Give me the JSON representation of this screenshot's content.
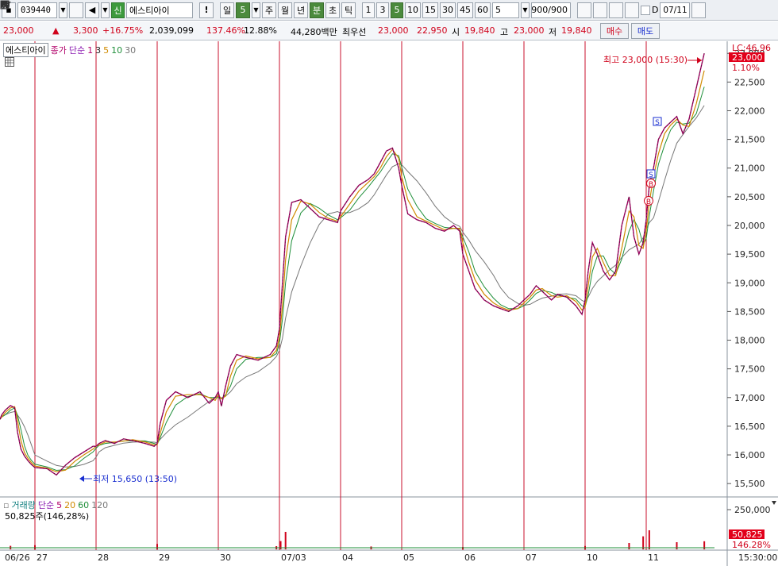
{
  "toolbar": {
    "stock_code": "039440",
    "credit_badge": "신",
    "stock_name": "에스티아이",
    "alert_label": "!",
    "period_value_label": "일",
    "period_value_num": "5",
    "periods": [
      "주",
      "월",
      "년",
      "분",
      "초",
      "틱"
    ],
    "intervals": [
      "1",
      "3",
      "5",
      "10",
      "15",
      "30",
      "45",
      "60"
    ],
    "interval_active": "5",
    "custom_interval": "5",
    "count": "900/900",
    "checkbox_label": "D",
    "date": "07/11"
  },
  "quote": {
    "price": "23,000",
    "change_arrow": "▲",
    "change": "3,300",
    "change_pct": "+16.75%",
    "volume": "2,039,099",
    "volume_ratio": "137.46%",
    "turnover": "12.88%",
    "amount": "44,280백만",
    "priority_label": "최우선",
    "ask": "23,000",
    "bid": "22,950",
    "open_label": "시",
    "open": "19,840",
    "high_label": "고",
    "high": "23,000",
    "low_label": "저",
    "low": "19,840",
    "buy_label": "매수",
    "sell_label": "매도"
  },
  "price_legend": {
    "name": "에스티아이",
    "series_label": "종가",
    "ma_type": "단순",
    "periods": [
      "1",
      "3",
      "5",
      "10",
      "30"
    ]
  },
  "volume_legend": {
    "name": "거래량",
    "ma_type": "단순",
    "periods": [
      "5",
      "20",
      "60",
      "120"
    ],
    "current": "50,825주(146,28%)"
  },
  "annotations": {
    "high": "최고 23,000 (15:30)",
    "low": "최저 15,650 (13:50)",
    "lc_label": "LC:46.96",
    "last_price": "23,000",
    "last_pct": "1.10%",
    "last_volume": "50,825",
    "last_volume_pct": "146.28%",
    "end_time": "15:30:00"
  },
  "colors": {
    "up": "#d0021b",
    "down": "#1a2fd0",
    "day_line": "#c8102e",
    "ma1": "#b1006a",
    "ma3": "#222222",
    "ma5": "#d08a00",
    "ma10": "#1f8f3a",
    "ma30": "#777777"
  },
  "chart_data": {
    "type": "line",
    "title": "",
    "ylabel": "",
    "xlabel": "",
    "ylim": [
      15350,
      23100
    ],
    "yticks": [
      15500,
      16000,
      16500,
      17000,
      17500,
      18000,
      18500,
      19000,
      19500,
      20000,
      20500,
      21000,
      21500,
      22000,
      22500,
      23000
    ],
    "ytick_labels": [
      "15,500",
      "16,000",
      "16,500",
      "17,000",
      "17,500",
      "18,000",
      "18,500",
      "19,000",
      "19,500",
      "20,000",
      "20,500",
      "21,000",
      "21,500",
      "22,000",
      "22,500",
      "23,000"
    ],
    "days": [
      "06/26",
      "27",
      "28",
      "29",
      "30",
      "07/03",
      "04",
      "05",
      "06",
      "07",
      "10",
      "11"
    ],
    "x_days": [
      0.0,
      0.05,
      0.15,
      0.3,
      0.42,
      0.5,
      0.6,
      0.7,
      0.8,
      0.9,
      1.0,
      1.2,
      1.35,
      1.5,
      1.65,
      1.8,
      1.95,
      2.0,
      2.05,
      2.15,
      2.3,
      2.45,
      2.6,
      2.8,
      2.95,
      3.0,
      3.05,
      3.15,
      3.3,
      3.5,
      3.7,
      3.85,
      3.95,
      4.0,
      4.05,
      4.12,
      4.2,
      4.3,
      4.45,
      4.65,
      4.85,
      4.95,
      5.0,
      5.05,
      5.1,
      5.2,
      5.35,
      5.5,
      5.65,
      5.8,
      5.95,
      6.0,
      6.15,
      6.3,
      6.45,
      6.55,
      6.65,
      6.75,
      6.85,
      6.95,
      7.0,
      7.1,
      7.25,
      7.4,
      7.55,
      7.7,
      7.85,
      7.95,
      8.0,
      8.1,
      8.2,
      8.35,
      8.5,
      8.62,
      8.75,
      8.9,
      9.0,
      9.1,
      9.2,
      9.3,
      9.45,
      9.55,
      9.7,
      9.85,
      9.95,
      10.0,
      10.05,
      10.12,
      10.2,
      10.3,
      10.4,
      10.5,
      10.6,
      10.72,
      10.8,
      10.88,
      10.95,
      11.0,
      11.05,
      11.12,
      11.2,
      11.3,
      11.4,
      11.5,
      11.6,
      11.7,
      11.82,
      11.95
    ],
    "close": [
      16620,
      16700,
      16780,
      16860,
      16820,
      16400,
      16100,
      15980,
      15900,
      15830,
      15780,
      15760,
      15650,
      15820,
      15950,
      16050,
      16150,
      16150,
      16200,
      16250,
      16200,
      16280,
      16250,
      16200,
      16150,
      16200,
      16550,
      16950,
      17100,
      17000,
      17100,
      16900,
      17000,
      17100,
      16850,
      17200,
      17550,
      17750,
      17700,
      17650,
      17750,
      17900,
      18200,
      19000,
      19800,
      20400,
      20450,
      20300,
      20150,
      20100,
      20050,
      20250,
      20500,
      20700,
      20800,
      20900,
      21100,
      21300,
      21350,
      21000,
      20700,
      20200,
      20100,
      20050,
      19950,
      19900,
      20000,
      19900,
      19500,
      19200,
      18900,
      18700,
      18600,
      18550,
      18500,
      18600,
      18700,
      18800,
      18950,
      18850,
      18700,
      18800,
      18750,
      18600,
      18450,
      18700,
      19200,
      19700,
      19500,
      19200,
      19050,
      19200,
      20000,
      20500,
      19800,
      19500,
      19700,
      20100,
      20700,
      21000,
      21500,
      21700,
      21800,
      21900,
      21600,
      21850,
      22400,
      23000
    ],
    "vol_days": [
      0.3,
      1.0,
      3.0,
      4.95,
      5.02,
      5.1,
      6.5,
      8.0,
      10.0,
      10.72,
      10.95,
      11.05,
      11.5,
      11.95
    ],
    "volume": [
      22000,
      26000,
      34000,
      20000,
      52000,
      110000,
      18000,
      15000,
      21000,
      40000,
      82000,
      120000,
      45000,
      50825
    ],
    "vol_ylim": [
      0,
      300000
    ],
    "vol_ticks": [
      250000
    ],
    "vol_tick_labels": [
      "250,000"
    ]
  }
}
